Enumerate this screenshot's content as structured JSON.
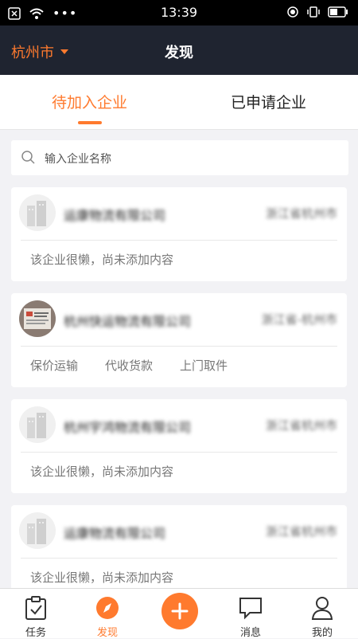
{
  "status_bar": {
    "time": "13:39"
  },
  "header": {
    "city": "杭州市",
    "title": "发现"
  },
  "tabs": {
    "active": "待加入企业",
    "other": "已申请企业"
  },
  "search": {
    "placeholder": "输入企业名称"
  },
  "companies": [
    {
      "name": "运康物流有限公司",
      "location": "浙江省杭州市",
      "description": "该企业很懒，尚未添加内容"
    },
    {
      "name": "杭州快运物流有限公司",
      "location": "浙江省-杭州市",
      "tags": [
        "保价运输",
        "代收货款",
        "上门取件"
      ]
    },
    {
      "name": "杭州宇鸿物流有限公司",
      "location": "浙江省杭州市",
      "description": "该企业很懒，尚未添加内容"
    },
    {
      "name": "运康物流有限公司",
      "location": "浙江省杭州市",
      "description": "该企业很懒，尚未添加内容"
    }
  ],
  "bottom_nav": {
    "tasks": "任务",
    "discover": "发现",
    "messages": "消息",
    "mine": "我的"
  },
  "colors": {
    "accent": "#ff7a2e",
    "header_bg": "#1f2430"
  }
}
